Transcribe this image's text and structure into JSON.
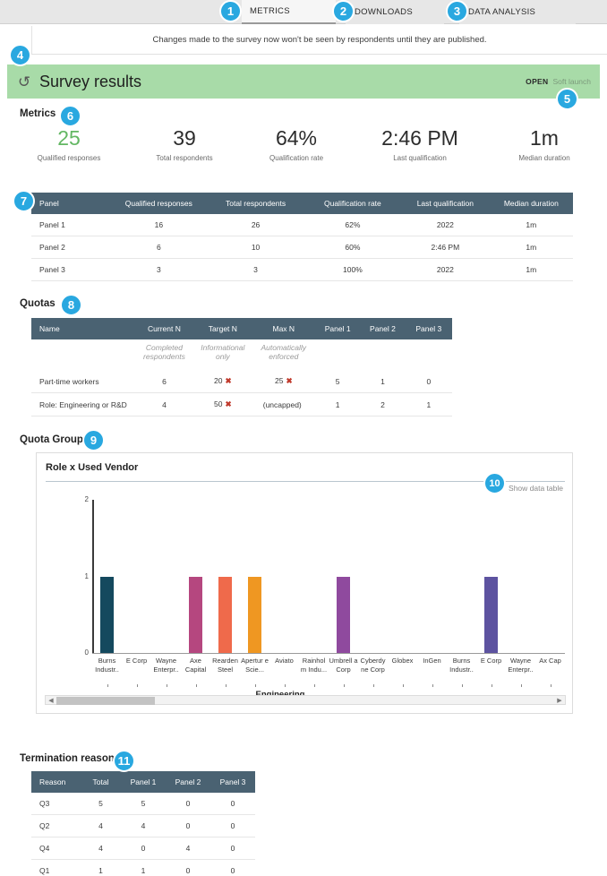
{
  "tabs": [
    {
      "label": "METRICS",
      "active": true
    },
    {
      "label": "DOWNLOADS",
      "active": false
    },
    {
      "label": "DATA ANALYSIS",
      "active": false
    }
  ],
  "notice": {
    "text": "Changes made to the survey now won't be seen by respondents until they are published."
  },
  "banner": {
    "icon": "refresh-icon",
    "title": "Survey results",
    "status": "OPEN",
    "mode": "Soft launch"
  },
  "metrics": {
    "label": "Metrics",
    "items": [
      {
        "value": "25",
        "label": "Qualified responses",
        "color": "#63b763"
      },
      {
        "value": "39",
        "label": "Total respondents",
        "color": "#2c2c2c"
      },
      {
        "value": "64%",
        "label": "Qualification rate",
        "color": "#2c2c2c"
      },
      {
        "value": "2:46 PM",
        "label": "Last qualification",
        "color": "#2c2c2c"
      },
      {
        "value": "1m",
        "label": "Median duration",
        "color": "#2c2c2c"
      }
    ]
  },
  "panel_table": {
    "headers": [
      "Panel",
      "Qualified responses",
      "Total respondents",
      "Qualification rate",
      "Last qualification",
      "Median duration"
    ],
    "rows": [
      [
        "Panel 1",
        "16",
        "26",
        "62%",
        "2022",
        "1m"
      ],
      [
        "Panel 2",
        "6",
        "10",
        "60%",
        "2:46 PM",
        "1m"
      ],
      [
        "Panel 3",
        "3",
        "3",
        "100%",
        "2022",
        "1m"
      ]
    ]
  },
  "quotas": {
    "label": "Quotas",
    "headers": [
      "Name",
      "Current N",
      "Target N",
      "Max N",
      "Panel 1",
      "Panel 2",
      "Panel 3"
    ],
    "subheaders": [
      "",
      "Completed respondents",
      "Informational only",
      "Automatically enforced",
      "",
      "",
      ""
    ],
    "rows": [
      {
        "name": "Part-time workers",
        "current_n": "6",
        "target_n": "20",
        "target_n_flag": "✖",
        "max_n": "25",
        "max_n_flag": "✖",
        "panel1": "5",
        "panel2": "1",
        "panel3": "0"
      },
      {
        "name": "Role: Engineering or R&D",
        "current_n": "4",
        "target_n": "50",
        "target_n_flag": "✖",
        "max_n": "(uncapped)",
        "max_n_flag": "",
        "panel1": "1",
        "panel2": "2",
        "panel3": "1"
      }
    ]
  },
  "quota_groups": {
    "label": "Quota Groups",
    "card_title": "Role x Used Vendor",
    "show_data_table": "Show data table"
  },
  "chart_data": {
    "type": "bar",
    "title": "Role x Used Vendor",
    "xlabel": "Engineering",
    "ylabel": "",
    "ylim": [
      0,
      2
    ],
    "yticks": [
      "0",
      "1",
      "2"
    ],
    "grid": false,
    "legend": "none",
    "categories": [
      "Burns Industr..",
      "E Corp",
      "Wayne Enterpr..",
      "Axe Capital",
      "Rearden Steel",
      "Apertur e Scie...",
      "Aviato",
      "Rainhol m Indu...",
      "Umbrell a Corp",
      "Cyberdy ne Corp",
      "Globex",
      "InGen",
      "Burns Industr..",
      "E Corp",
      "Wayne Enterpr..",
      "Ax Cap"
    ],
    "values": [
      1,
      0,
      0,
      1,
      1,
      1,
      0,
      0,
      1,
      0,
      0,
      0,
      0,
      1,
      0,
      0
    ],
    "colors": [
      "#14495e",
      "",
      "",
      "#b5477f",
      "#ef6a4b",
      "#ef9722",
      "",
      "",
      "#8f4a9e",
      "",
      "",
      "",
      "",
      "#5d53a0",
      "",
      ""
    ],
    "group_label": "Engineering"
  },
  "termination": {
    "label": "Termination reasons",
    "headers": [
      "Reason",
      "Total",
      "Panel 1",
      "Panel 2",
      "Panel 3"
    ],
    "rows": [
      [
        "Q3",
        "5",
        "5",
        "0",
        "0"
      ],
      [
        "Q2",
        "4",
        "4",
        "0",
        "0"
      ],
      [
        "Q4",
        "4",
        "0",
        "4",
        "0"
      ],
      [
        "Q1",
        "1",
        "1",
        "0",
        "0"
      ]
    ]
  },
  "callouts": [
    {
      "n": "1"
    },
    {
      "n": "2"
    },
    {
      "n": "3"
    },
    {
      "n": "4"
    },
    {
      "n": "5"
    },
    {
      "n": "6"
    },
    {
      "n": "7"
    },
    {
      "n": "8"
    },
    {
      "n": "9"
    },
    {
      "n": "10"
    },
    {
      "n": "11"
    }
  ]
}
